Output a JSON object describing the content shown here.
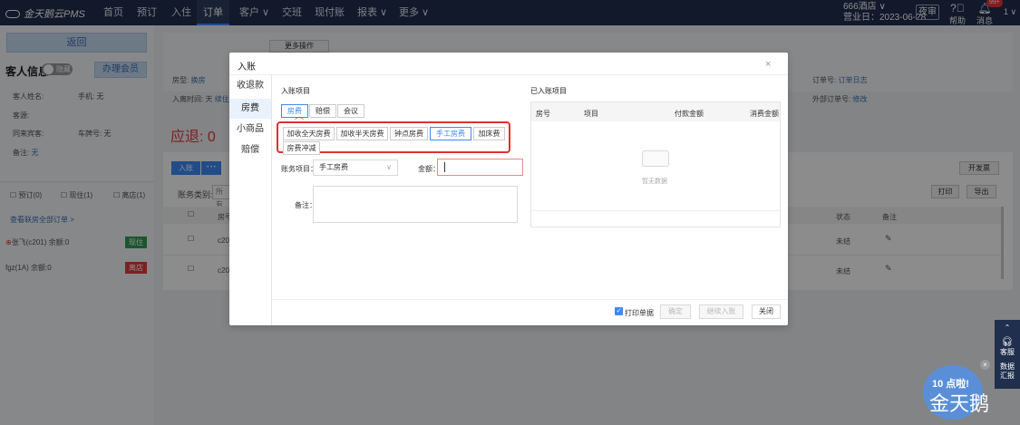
{
  "nav": {
    "logo": "金天鹅云PMS",
    "items": [
      "首页",
      "预订",
      "入住",
      "订单",
      "客户 ∨",
      "交班",
      "现付账",
      "报表 ∨",
      "更多 ∨"
    ],
    "hotel_name": "666酒店 ∨",
    "business_date": "营业日：2023-06-28",
    "night_button": "夜审",
    "help_label": "帮助",
    "message_label": "消息",
    "badge_count": "99+",
    "user_short": "1 ∨"
  },
  "left": {
    "back_button": "返回",
    "guest_info_title": "客人信息",
    "toggle_label": "隐藏",
    "member_button": "办理会员",
    "name_label": "客人姓名:",
    "phone_label": "手机: 无",
    "source_label": "客源:",
    "companion_label": "同来宾客:",
    "plate_label": "车牌号: 无",
    "remark_label": "备注:",
    "remark_value": "无",
    "filters": [
      "预订(0)",
      "现住(1)",
      "离店(1)"
    ],
    "view_all_link": "查看联房全部订单 >",
    "rooms": [
      {
        "name": "张飞(c201)",
        "balance": "余额:0",
        "status": "现住",
        "status_color": "#2f9d55"
      },
      {
        "name": "fgz(1A)",
        "balance": "余额:0",
        "status": "离店",
        "status_color": "#e23b3b"
      }
    ]
  },
  "main": {
    "more_ops": "更多操作",
    "room_type_label": "房型:",
    "room_type_value": "换房",
    "checkin_time_label": "入离时间: 天",
    "checkin_link": "续住",
    "order_no_label": "订单号:",
    "order_log_link": "订单日志",
    "ext_order_label": "外部订单号:",
    "ext_order_link": "修改",
    "refund_label": "应退: 0",
    "post_button": "入账",
    "more_dots": "• • •",
    "invoice_button": "开发票",
    "category_label": "账务类别:",
    "category_value": "所有",
    "print_button": "打印",
    "export_button": "导出",
    "col_room": "房号",
    "col_status": "状态",
    "col_remark": "备注",
    "rows": [
      {
        "room": "c20",
        "status": "未结"
      },
      {
        "room": "c20",
        "status": "未结"
      }
    ]
  },
  "modal": {
    "title": "入账",
    "close": "×",
    "side_menu": [
      "收退款",
      "房费",
      "小商品",
      "赔偿"
    ],
    "active_side": 1,
    "items_title": "入账项目",
    "posted_title": "已入账项目",
    "tabs": [
      "房费",
      "赔偿",
      "会议"
    ],
    "subtabs": [
      "加收全天房费",
      "加收半天房费",
      "钟点房费",
      "手工房费",
      "加床费",
      "房费冲减"
    ],
    "account_item_label": "账务项目：",
    "account_item_value": "手工房费",
    "amount_label": "金额：",
    "remark_label": "备注：",
    "table_cols": [
      "房号",
      "项目",
      "付款金额",
      "消费金额"
    ],
    "empty_text": "暂无数据",
    "print_receipt": "打印单据",
    "confirm_button": "确定",
    "continue_button": "继续入账",
    "close_button": "关闭"
  },
  "widget": {
    "service_label": "客服",
    "report_label": "数据汇报",
    "promo_text": "10 点啦!",
    "brand_text": "金天鹅",
    "close": "×"
  },
  "colors": {
    "nav_bg": "#1f2f4d",
    "accent": "#3d8af7",
    "highlight_red": "#e03131"
  }
}
